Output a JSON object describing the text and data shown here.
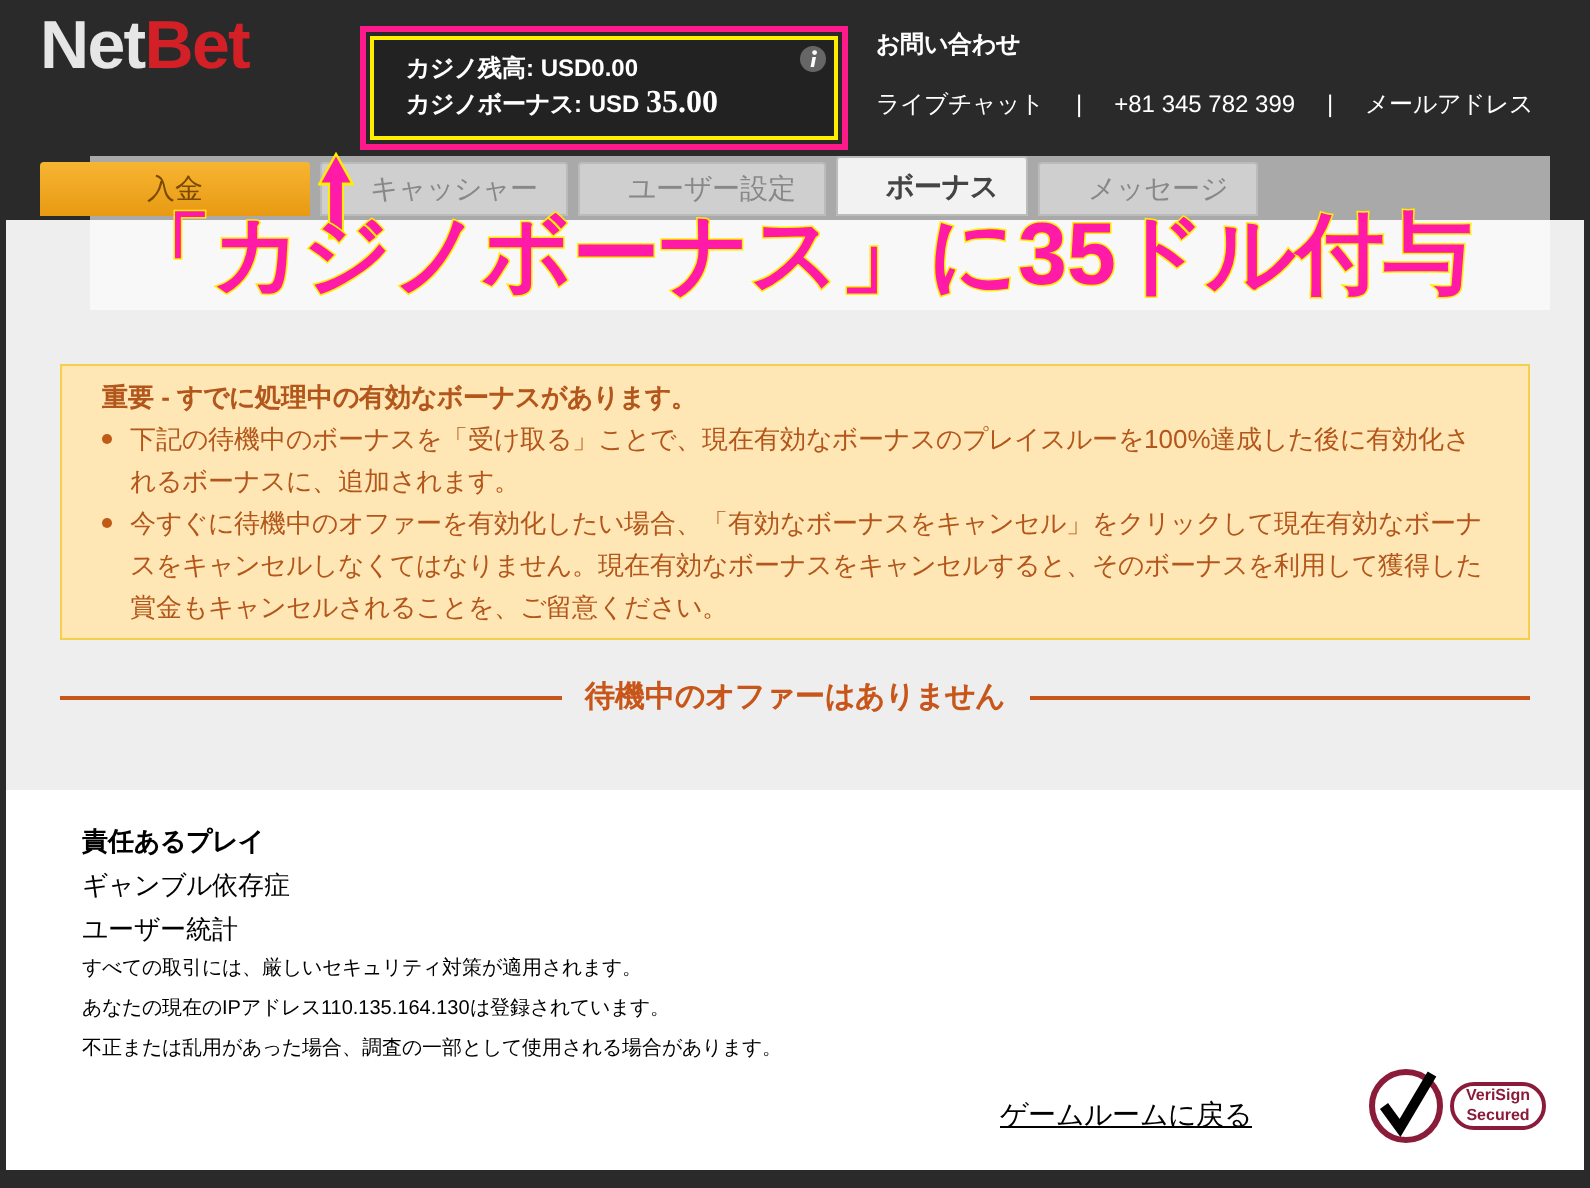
{
  "header": {
    "logo": {
      "first": "Net",
      "second": "Bet"
    },
    "balance": {
      "cash_label": "カジノ残高:",
      "cash_value": "USD0.00",
      "bonus_label": "カジノボーナス:",
      "bonus_currency": "USD",
      "bonus_amount": "35.00"
    },
    "contact": {
      "title": "お問い合わせ",
      "items": [
        "ライブチャット",
        "|",
        "+81 345 782 399",
        "|",
        "メールアドレス"
      ]
    }
  },
  "tabs": [
    {
      "label": "入金",
      "kind": "deposit",
      "selected": false
    },
    {
      "label": "キャッシャー",
      "kind": "tab",
      "selected": false
    },
    {
      "label": "ユーザー設定",
      "kind": "tab",
      "selected": false
    },
    {
      "label": "ボーナス",
      "kind": "tab",
      "selected": true
    },
    {
      "label": "メッセージ",
      "kind": "tab",
      "selected": false
    }
  ],
  "annotation": {
    "caption": "「カジノボーナス」に35ドル付与"
  },
  "notice": {
    "title": "重要 - すでに処理中の有効なボーナスがあります。",
    "items": [
      "下記の待機中のボーナスを「受け取る」ことで、現在有効なボーナスのプレイスルーを100%達成した後に有効化されるボーナスに、追加されます。",
      "今すぐに待機中のオファーを有効化したい場合、「有効なボーナスをキャンセル」をクリックして現在有効なボーナスをキャンセルしなくてはなりません。現在有効なボーナスをキャンセルすると、そのボーナスを利用して獲得した賞金もキャンセルされることを、ご留意ください。"
    ]
  },
  "empty_offers": "待機中のオファーはありません",
  "footer": {
    "heading": "責任あるプレイ",
    "links": [
      "ギャンブル依存症",
      "ユーザー統計"
    ],
    "notes": [
      "すべての取引には、厳しいセキュリティ対策が適用されます。",
      "あなたの現在のIPアドレス110.135.164.130は登録されています。",
      "不正または乱用があった場合、調査の一部として使用される場合があります。"
    ],
    "back_link": "ゲームルームに戻る",
    "badge": {
      "line1": "VeriSign",
      "line2": "Secured"
    }
  }
}
